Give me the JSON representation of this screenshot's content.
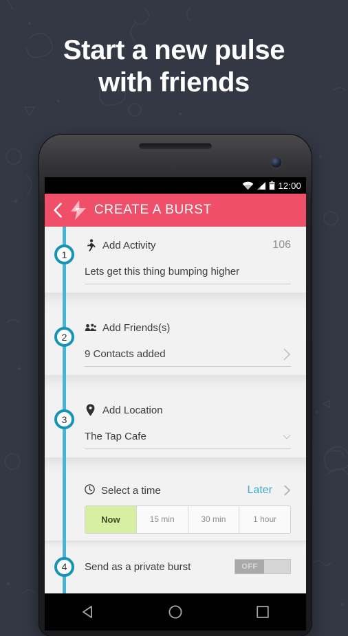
{
  "headline": {
    "line1": "Start a new pulse",
    "line2": "with friends"
  },
  "colors": {
    "background": "#343845",
    "accent_pink": "#f04f69",
    "timeline_teal": "#4bb3d4",
    "marker_teal": "#1694b4",
    "link_teal": "#3fa8c6",
    "active_green": "#d7efa2",
    "screen_bg": "#f2f2f2"
  },
  "statusbar": {
    "wifi_icon": "wifi-icon",
    "signal_icon": "signal-bars-icon",
    "battery_icon": "battery-icon",
    "clock": "12:00"
  },
  "appbar": {
    "back_icon": "back-chevron-icon",
    "logo_icon": "lightning-bolt-icon",
    "title": "CREATE A BURST"
  },
  "steps": [
    {
      "number": "1",
      "icon": "walking-person-icon",
      "label": "Add Activity",
      "counter": "106",
      "value": "Lets get this thing bumping higher",
      "trailing_icon": ""
    },
    {
      "number": "2",
      "icon": "people-group-icon",
      "label": "Add Friends(s)",
      "counter": "",
      "value": "9 Contacts added",
      "trailing_icon": "chevron-right-icon"
    },
    {
      "number": "3",
      "icon": "map-pin-icon",
      "label": "Add Location",
      "counter": "",
      "value": "The Tap Cafe",
      "trailing_icon": "chevron-down-icon"
    }
  ],
  "time_section": {
    "icon": "clock-icon",
    "label": "Select a time",
    "later_label": "Later",
    "later_chevron": "chevron-right-icon",
    "options": [
      {
        "label": "Now",
        "selected": true
      },
      {
        "label": "15 min",
        "selected": false
      },
      {
        "label": "30 min",
        "selected": false
      },
      {
        "label": "1 hour",
        "selected": false
      }
    ]
  },
  "private_step": {
    "number": "4",
    "label": "Send as a private burst",
    "toggle_state": "OFF"
  },
  "navbar": {
    "back_icon": "nav-back-triangle-icon",
    "home_icon": "nav-home-circle-icon",
    "recents_icon": "nav-recents-square-icon"
  }
}
